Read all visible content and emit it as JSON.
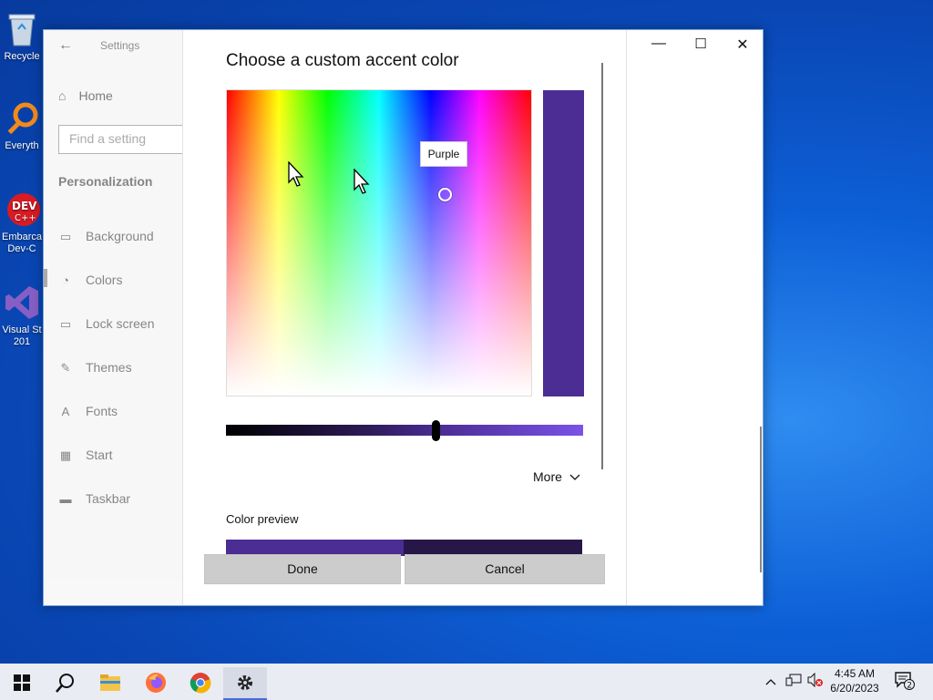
{
  "desktop": {
    "icons": [
      {
        "label": "Recycle"
      },
      {
        "label": "Everyth"
      },
      {
        "label": "Embarca Dev-C"
      },
      {
        "label": "Visual St 201"
      }
    ]
  },
  "window": {
    "title": "Settings",
    "controls": {
      "minimize": "—",
      "maximize": "☐",
      "close": "✕"
    }
  },
  "sidebar": {
    "home": "Home",
    "search_placeholder": "Find a setting",
    "section": "Personalization",
    "items": [
      {
        "label": "Background",
        "icon": "image-icon"
      },
      {
        "label": "Colors",
        "icon": "palette-icon"
      },
      {
        "label": "Lock screen",
        "icon": "lock-screen-icon"
      },
      {
        "label": "Themes",
        "icon": "themes-icon"
      },
      {
        "label": "Fonts",
        "icon": "fonts-icon"
      },
      {
        "label": "Start",
        "icon": "start-icon"
      },
      {
        "label": "Taskbar",
        "icon": "taskbar-icon"
      }
    ],
    "active": "Colors"
  },
  "dialog": {
    "title": "Choose a custom accent color",
    "tooltip": "Purple",
    "selected_color": "#4b2d94",
    "brightness_fraction": 0.6,
    "more_label": "More",
    "preview_label": "Color preview",
    "done_label": "Done",
    "cancel_label": "Cancel"
  },
  "taskbar": {
    "apps": [
      "start-icon",
      "search-icon",
      "file-explorer-icon",
      "firefox-icon",
      "chrome-icon",
      "settings-icon"
    ],
    "active_app": "settings-icon",
    "time": "4:45 AM",
    "date": "6/20/2023",
    "notification_count": "2"
  }
}
